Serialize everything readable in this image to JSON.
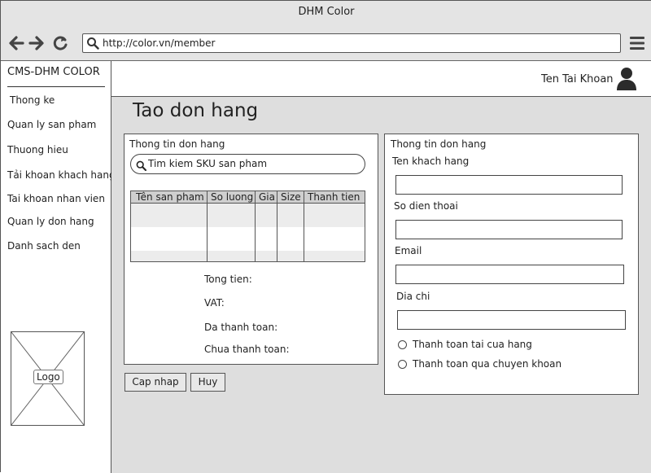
{
  "window": {
    "title": "DHM Color"
  },
  "browser": {
    "url": "http://color.vn/member",
    "back_icon": "arrow-left-icon",
    "forward_icon": "arrow-right-icon",
    "refresh_icon": "refresh-icon",
    "menu_icon": "hamburger-icon"
  },
  "sidebar": {
    "brand": "CMS-DHM COLOR",
    "items": [
      {
        "label": "Thong ke"
      },
      {
        "label": "Quan ly san pham"
      },
      {
        "label": "Thuong hieu"
      },
      {
        "label": "Tải khoan khach hang"
      },
      {
        "label": "Tai khoan nhan vien"
      },
      {
        "label": "Quan ly don hang"
      },
      {
        "label": "Danh sach den"
      }
    ],
    "logo_label": "Logo"
  },
  "header": {
    "account_name": "Ten Tai Khoan"
  },
  "page": {
    "title": "Tao don hang"
  },
  "order_panel": {
    "title": "Thong tin don hang",
    "search_placeholder": "Tim kiem SKU san pham",
    "table": {
      "columns": [
        "Tên san pham",
        "So luong",
        "Gia",
        "Size",
        "Thanh tien"
      ],
      "rows": []
    },
    "summary": {
      "total_label": "Tong tien:",
      "vat_label": "VAT:",
      "paid_label": "Da thanh toan:",
      "unpaid_label": "Chua thanh toan:"
    }
  },
  "customer_panel": {
    "title": "Thong tin don hang",
    "fields": [
      {
        "label": "Ten khach hang",
        "value": ""
      },
      {
        "label": "So dien thoai",
        "value": ""
      },
      {
        "label": "Email",
        "value": ""
      },
      {
        "label": "Dia chi",
        "value": ""
      }
    ],
    "payment_options": [
      {
        "label": "Thanh toan tai cua hang",
        "selected": false
      },
      {
        "label": "Thanh toan qua chuyen khoan",
        "selected": false
      }
    ]
  },
  "actions": {
    "update_label": "Cap nhap",
    "cancel_label": "Huy"
  }
}
